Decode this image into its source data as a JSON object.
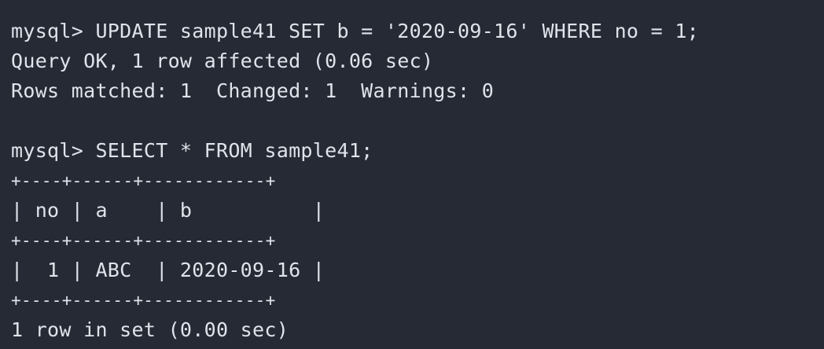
{
  "terminal": {
    "background": "#262a34",
    "foreground": "#dfe3ea",
    "lines": {
      "l0": "mysql> UPDATE sample41 SET b = '2020-09-16' WHERE no = 1;",
      "l1": "Query OK, 1 row affected (0.06 sec)",
      "l2": "Rows matched: 1  Changed: 1  Warnings: 0",
      "l3": "",
      "l4": "mysql> SELECT * FROM sample41;",
      "l5": "+----+------+------------+",
      "l6": "| no | a    | b          |",
      "l7": "+----+------+------------+",
      "l8": "|  1 | ABC  | 2020-09-16 |",
      "l9": "+----+------+------------+",
      "l10": "1 row in set (0.00 sec)"
    }
  }
}
